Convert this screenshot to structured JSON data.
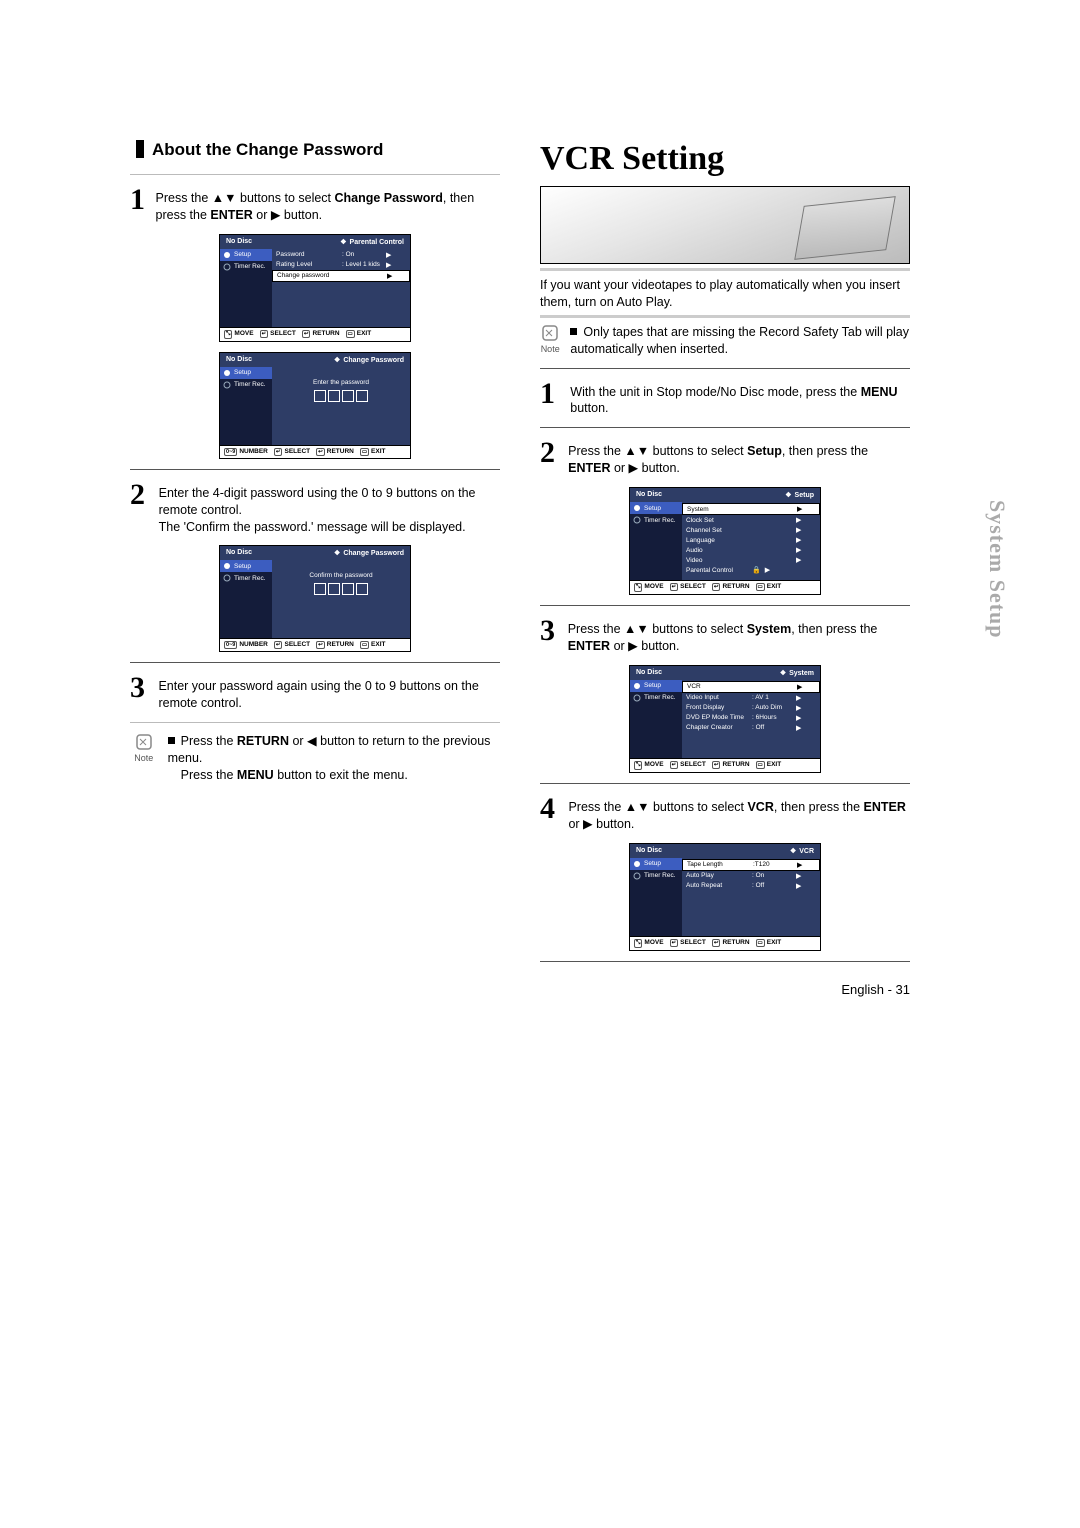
{
  "side_tab": "System Setup",
  "footer": "English - 31",
  "left": {
    "title": "About the Change Password",
    "steps": {
      "s1": {
        "num": "1",
        "text_a": "Press the ▲▼ buttons to select ",
        "bold": "Change Password",
        "text_b": ", then press the ",
        "bold2": "ENTER",
        "text_c": " or ▶ button."
      },
      "s2": {
        "num": "2",
        "text": "Enter the 4-digit password using the 0 to 9 buttons on the remote control.\nThe 'Confirm the password.' message will be displayed."
      },
      "s3": {
        "num": "3",
        "text": "Enter your password again using the 0 to 9 buttons on the remote control."
      }
    },
    "note": {
      "label": "Note",
      "lines": [
        "Press the RETURN or ◀ button to return to the previous menu.",
        "Press the MENU button to exit the menu."
      ]
    },
    "osd1": {
      "topLeft": "No Disc",
      "topRight": "Parental Control",
      "leftItems": [
        {
          "label": "Setup",
          "selected": true
        },
        {
          "label": "Timer Rec."
        }
      ],
      "rows": [
        {
          "label": "Password",
          "value": ": On",
          "arrow": "▶"
        },
        {
          "label": "Rating Level",
          "value": ": Level 1 kids",
          "arrow": "▶"
        },
        {
          "label": "Change password",
          "selected": true,
          "arrow": "▶"
        }
      ],
      "footer": [
        "MOVE",
        "SELECT",
        "RETURN",
        "EXIT"
      ],
      "footIcons": [
        "⤡",
        "↵",
        "↩",
        "▭"
      ]
    },
    "osd2": {
      "topLeft": "No Disc",
      "topRight": "Change Password",
      "leftItems": [
        {
          "label": "Setup",
          "selected": true
        },
        {
          "label": "Timer Rec."
        }
      ],
      "centerText": "Enter the password",
      "footer": [
        "NUMBER",
        "SELECT",
        "RETURN",
        "EXIT"
      ],
      "footIcons": [
        "0~9",
        "↵",
        "↩",
        "▭"
      ]
    },
    "osd3": {
      "topLeft": "No Disc",
      "topRight": "Change Password",
      "leftItems": [
        {
          "label": "Setup",
          "selected": true
        },
        {
          "label": "Timer Rec."
        }
      ],
      "centerText": "Confirm the password",
      "footer": [
        "NUMBER",
        "SELECT",
        "RETURN",
        "EXIT"
      ],
      "footIcons": [
        "0~9",
        "↵",
        "↩",
        "▭"
      ]
    }
  },
  "right": {
    "title": "VCR Setting",
    "intro": "If you want your videotapes to play automatically when you insert them, turn on Auto Play.",
    "note": {
      "label": "Note",
      "text": "Only tapes that are missing the Record Safety Tab will play automatically when inserted."
    },
    "steps": {
      "s1": {
        "num": "1",
        "text_a": "With the unit in Stop mode/No Disc mode, press the ",
        "bold": "MENU",
        "text_b": " button."
      },
      "s2": {
        "num": "2",
        "text_a": "Press the ▲▼ buttons to select ",
        "bold": "Setup",
        "text_b": ", then press the ",
        "bold2": "ENTER",
        "text_c": " or ▶ button."
      },
      "s3": {
        "num": "3",
        "text_a": "Press the ▲▼ buttons to select ",
        "bold": "System",
        "text_b": ", then press the ",
        "bold2": "ENTER",
        "text_c": " or ▶ button."
      },
      "s4": {
        "num": "4",
        "text_a": "Press the ▲▼ buttons to select ",
        "bold": "VCR",
        "text_b": ", then press the ",
        "bold2": "ENTER",
        "text_c": " or ▶ button."
      }
    },
    "osd_setup": {
      "topLeft": "No Disc",
      "topRight": "Setup",
      "leftItems": [
        {
          "label": "Setup",
          "selected": true
        },
        {
          "label": "Timer Rec."
        }
      ],
      "rows": [
        {
          "label": "System",
          "selected": true,
          "arrow": "▶"
        },
        {
          "label": "Clock Set",
          "arrow": "▶"
        },
        {
          "label": "Channel Set",
          "arrow": "▶"
        },
        {
          "label": "Language",
          "arrow": "▶"
        },
        {
          "label": "Audio",
          "arrow": "▶"
        },
        {
          "label": "Video",
          "arrow": "▶"
        },
        {
          "label": "Parental Control",
          "lock": true,
          "arrow": "▶"
        }
      ],
      "footer": [
        "MOVE",
        "SELECT",
        "RETURN",
        "EXIT"
      ],
      "footIcons": [
        "⤡",
        "↵",
        "↩",
        "▭"
      ]
    },
    "osd_system": {
      "topLeft": "No Disc",
      "topRight": "System",
      "leftItems": [
        {
          "label": "Setup",
          "selected": true
        },
        {
          "label": "Timer Rec."
        }
      ],
      "rows": [
        {
          "label": "VCR",
          "selected": true,
          "arrow": "▶"
        },
        {
          "label": "Video Input",
          "value": ": AV 1",
          "arrow": "▶"
        },
        {
          "label": "Front Display",
          "value": ": Auto Dim",
          "arrow": "▶"
        },
        {
          "label": "DVD EP Mode Time",
          "value": ": 6Hours",
          "arrow": "▶"
        },
        {
          "label": "Chapter Creator",
          "value": ": Off",
          "arrow": "▶"
        }
      ],
      "footer": [
        "MOVE",
        "SELECT",
        "RETURN",
        "EXIT"
      ],
      "footIcons": [
        "⤡",
        "↵",
        "↩",
        "▭"
      ]
    },
    "osd_vcr": {
      "topLeft": "No Disc",
      "topRight": "VCR",
      "leftItems": [
        {
          "label": "Setup",
          "selected": true
        },
        {
          "label": "Timer Rec."
        }
      ],
      "rows": [
        {
          "label": "Tape Length",
          "value": ":T120",
          "selected": true,
          "arrow": "▶"
        },
        {
          "label": "Auto Play",
          "value": ": On",
          "arrow": "▶"
        },
        {
          "label": "Auto Repeat",
          "value": ": Off",
          "arrow": "▶"
        }
      ],
      "footer": [
        "MOVE",
        "SELECT",
        "RETURN",
        "EXIT"
      ],
      "footIcons": [
        "⤡",
        "↵",
        "↩",
        "▭"
      ]
    }
  }
}
